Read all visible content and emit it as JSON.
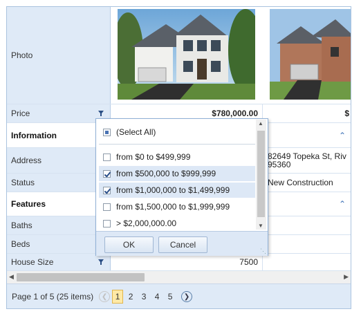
{
  "rows": {
    "photo": "Photo",
    "price": "Price",
    "information": "Information",
    "address": "Address",
    "status": "Status",
    "features": "Features",
    "baths": "Baths",
    "beds": "Beds",
    "house_size": "House Size"
  },
  "col1": {
    "price": "$780,000.00",
    "house_size": "7500"
  },
  "col2": {
    "price": "$",
    "address_line1": "82649 Topeka St, Riv",
    "address_line2": "95360",
    "status": "New Construction"
  },
  "filter_popup": {
    "select_all": "(Select All)",
    "options": [
      {
        "label": "from $0 to $499,999",
        "checked": false
      },
      {
        "label": "from $500,000 to $999,999",
        "checked": true
      },
      {
        "label": "from $1,000,000 to $1,499,999",
        "checked": true
      },
      {
        "label": "from $1,500,000 to $1,999,999",
        "checked": false
      },
      {
        "label": "> $2,000,000.00",
        "checked": false
      }
    ],
    "ok": "OK",
    "cancel": "Cancel"
  },
  "pager": {
    "info": "Page 1 of 5 (25 items)",
    "pages": [
      "1",
      "2",
      "3",
      "4",
      "5"
    ],
    "current": "1"
  },
  "colors": {
    "header_bg": "#dfeaf7",
    "accent": "#3a6fb5",
    "selected_page": "#ffe9a6"
  }
}
